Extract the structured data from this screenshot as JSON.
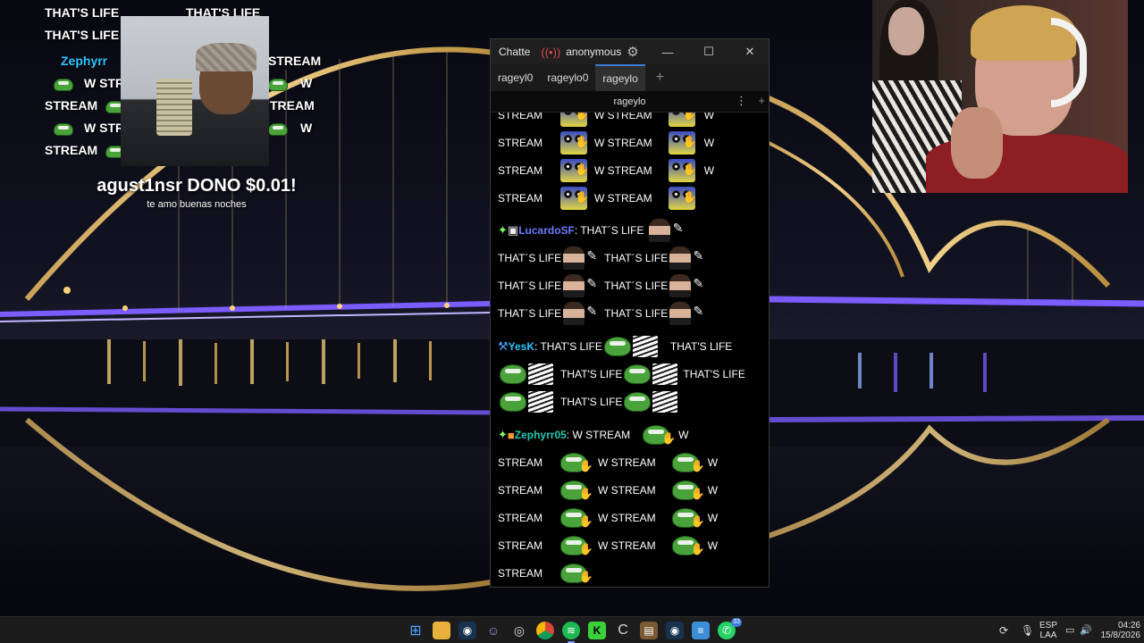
{
  "overlay": {
    "rows": [
      {
        "text": "THAT'S LIFE",
        "user": ""
      },
      {
        "text": "THAT'S LIFE",
        "user": ""
      },
      {
        "text": "THAT'S LIFE",
        "user": ""
      },
      {
        "text": "",
        "user": "Zephyrr"
      },
      {
        "text": "STREAM",
        "user": ""
      },
      {
        "text": "W STREAM",
        "user": ""
      },
      {
        "text": "W",
        "user": ""
      },
      {
        "text": "STREAM",
        "user": ""
      },
      {
        "text": "TREAM",
        "user": ""
      },
      {
        "text": "W STR",
        "user": ""
      },
      {
        "text": "W",
        "user": ""
      },
      {
        "text": "STREAM",
        "user": ""
      }
    ],
    "donation_title": "agust1nsr DONO $0.01!",
    "donation_message": "te amo buenas noches"
  },
  "chat_window": {
    "app_title": "Chatte",
    "account": "anonymous",
    "live_icon": "broadcast-icon",
    "settings_icon": "gear-icon",
    "controls": {
      "minimize": "—",
      "maximize": "☐",
      "close": "✕"
    },
    "tabs": [
      {
        "label": "rageyl0",
        "active": false
      },
      {
        "label": "rageylo0",
        "active": false
      },
      {
        "label": "rageylo",
        "active": true
      }
    ],
    "add_tab": "+",
    "split_title": "rageylo",
    "split_menu_icon": "⋮",
    "split_add_icon": "+",
    "messages": [
      {
        "user": "",
        "user_color": "#ffffff",
        "lines": [
          "STREAM",
          "W STREAM",
          "W",
          "STREAM",
          "W STREAM",
          "W",
          "STREAM",
          "W STREAM",
          "W",
          "STREAM",
          "W STREAM"
        ]
      },
      {
        "user": "LucardoSF",
        "user_color": "#6b7bff",
        "text": ": THAT´S LIFE",
        "lines": [
          "THAT´S LIFE",
          "THAT´S LIFE",
          "THAT´S LIFE",
          "THAT´S LIFE",
          "THAT´S LIFE",
          "THAT´S LIFE"
        ]
      },
      {
        "user": "YesK",
        "user_color": "#2cc6ff",
        "text": ": THAT'S LIFE",
        "lines": [
          "THAT'S LIFE",
          "THAT'S LIFE",
          "THAT'S LIFE",
          "THAT'S LIFE",
          "THAT'S LIFE"
        ]
      },
      {
        "user": "Zephyrr05",
        "user_color": "#24c6b2",
        "text": ": W STREAM",
        "lines": [
          "W",
          "STREAM",
          "W STREAM",
          "W",
          "STREAM",
          "W STREAM",
          "W",
          "STREAM",
          "W STREAM",
          "W",
          "STREAM",
          "W STREAM",
          "W",
          "STREAM"
        ]
      }
    ]
  },
  "taskbar": {
    "icons": [
      "windows-start-icon",
      "file-explorer-icon",
      "steam-icon",
      "discord-icon",
      "obs-icon",
      "chrome-icon",
      "spotify-icon",
      "kick-icon",
      "ccleaner-icon",
      "minecraft-icon",
      "steam-icon-2",
      "notepad-icon",
      "whatsapp-icon"
    ],
    "whatsapp_badge": "33",
    "tray": {
      "language": "ESP",
      "layout": "LAA",
      "time": "04:26",
      "date": "15/8/2026"
    }
  },
  "colors": {
    "accent": "#3d7bd6",
    "chat_bg": "#000000",
    "bridge_gold": "#d9a94a",
    "bridge_purple": "#7a5cff"
  }
}
